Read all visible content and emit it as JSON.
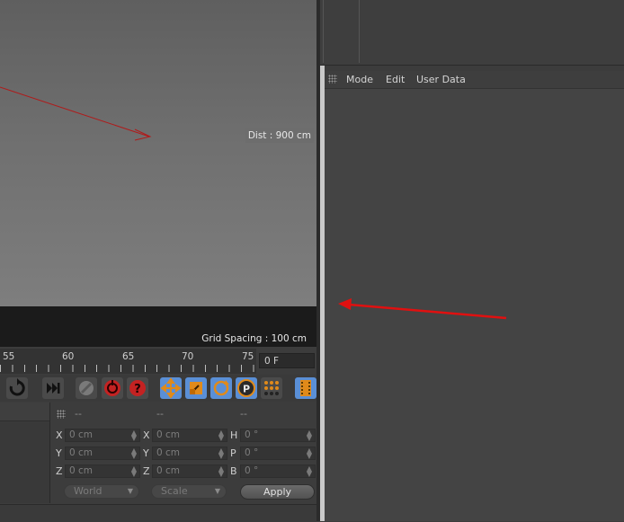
{
  "viewport": {
    "distance_label": "Dist : 900 cm",
    "grid_spacing": "Grid Spacing : 100 cm"
  },
  "attributes": {
    "menu": [
      "Mode",
      "Edit",
      "User Data"
    ]
  },
  "timeline": {
    "ticks": [
      "55",
      "60",
      "65",
      "70",
      "75"
    ],
    "current_frame": "0 F"
  },
  "coordinates": {
    "headers": [
      "--",
      "--",
      "--"
    ],
    "rows": [
      {
        "a": "X",
        "av": "0 cm",
        "b": "X",
        "bv": "0 cm",
        "c": "H",
        "cv": "0 °"
      },
      {
        "a": "Y",
        "av": "0 cm",
        "b": "Y",
        "bv": "0 cm",
        "c": "P",
        "cv": "0 °"
      },
      {
        "a": "Z",
        "av": "0 cm",
        "b": "Z",
        "bv": "0 cm",
        "c": "B",
        "cv": "0 °"
      }
    ],
    "mode_dropdown": "World",
    "size_dropdown": "Scale",
    "apply_label": "Apply"
  },
  "colors": {
    "accent_selected": "#5a8fd6",
    "annotation_red": "#e01010"
  },
  "toolbar_icons": [
    "loop-icon",
    "go-to-end-icon",
    "keyframe-disabled-icon",
    "record-active-icon",
    "autokey-help-icon",
    "move-key-icon",
    "scale-key-icon",
    "rotate-key-icon",
    "param-key-icon",
    "pla-key-icon",
    "film-icon"
  ]
}
